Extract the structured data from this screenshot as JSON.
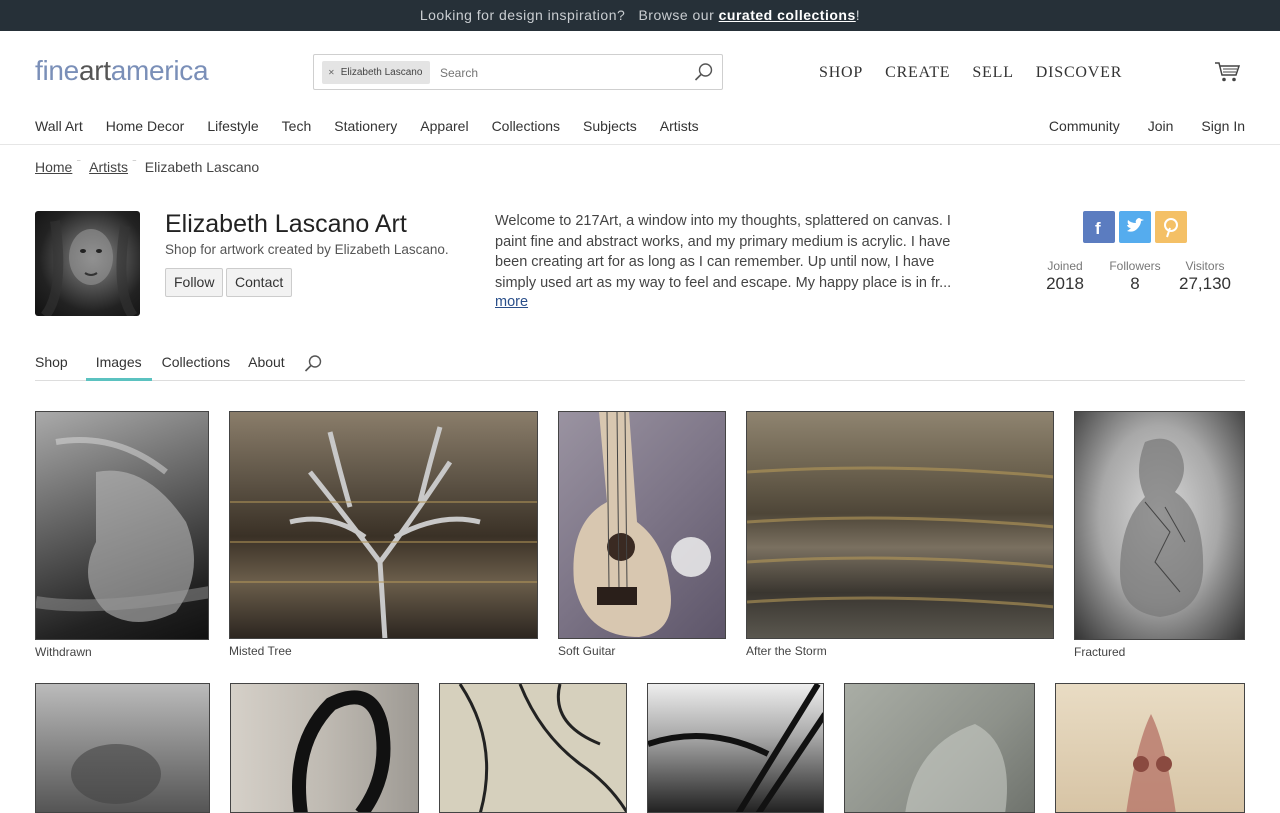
{
  "promo": {
    "text": "Looking for design inspiration?",
    "browse": "Browse our",
    "link": "curated collections",
    "end": "!"
  },
  "header": {
    "logo_parts": [
      "fine",
      "art",
      "america"
    ],
    "search": {
      "chip": "Elizabeth Lascano",
      "placeholder": "Search"
    },
    "main_nav": [
      "SHOP",
      "CREATE",
      "SELL",
      "DISCOVER"
    ]
  },
  "category_nav": {
    "left": [
      "Wall Art",
      "Home Decor",
      "Lifestyle",
      "Tech",
      "Stationery",
      "Apparel",
      "Collections",
      "Subjects",
      "Artists"
    ],
    "right": [
      "Community",
      "Join",
      "Sign In"
    ]
  },
  "breadcrumb": [
    "Home",
    "Artists",
    "Elizabeth Lascano"
  ],
  "artist": {
    "name": "Elizabeth Lascano Art",
    "subtitle": "Shop for artwork created by Elizabeth Lascano.",
    "follow_label": "Follow",
    "contact_label": "Contact",
    "bio": "Welcome to 217Art, a window into my thoughts, splattered on canvas.   I paint fine and abstract works, and my primary medium is acrylic.   I have been creating art for as long as I can remember.   Up until now, I have simply used art as my way to feel and escape.   My happy place is in fr...",
    "more_label": "more",
    "stats": [
      {
        "label": "Joined",
        "value": "2018"
      },
      {
        "label": "Followers",
        "value": "8"
      },
      {
        "label": "Visitors",
        "value": "27,130"
      }
    ],
    "social_colors": {
      "facebook": "#5b7cc0",
      "twitter": "#55acee",
      "pinterest": "#f4c066"
    }
  },
  "tabs": [
    "Shop",
    "Images",
    "Collections",
    "About"
  ],
  "active_tab": "Images",
  "artworks_row1": [
    "Withdrawn",
    "Misted Tree",
    "Soft Guitar",
    "After the Storm",
    "Fractured"
  ]
}
